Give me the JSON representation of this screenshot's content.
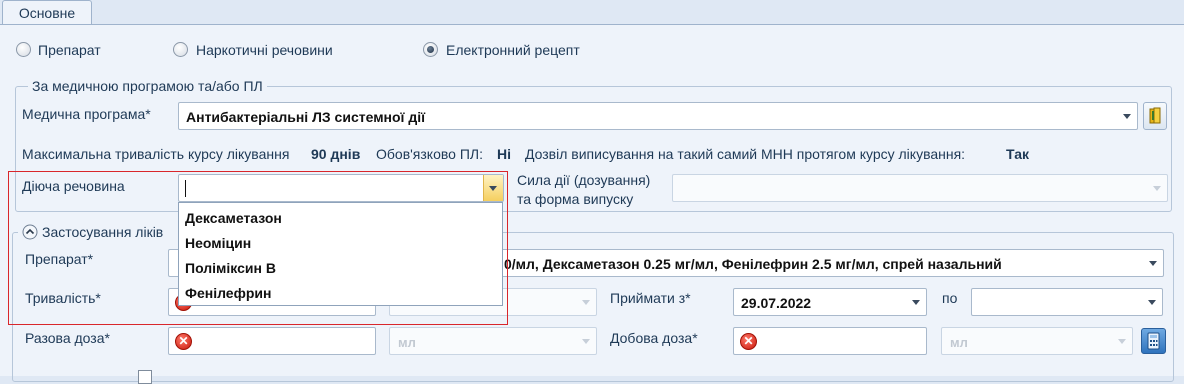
{
  "tab": {
    "label": "Основне"
  },
  "radios": [
    {
      "label": "Препарат",
      "checked": false
    },
    {
      "label": "Наркотичні речовини",
      "checked": false
    },
    {
      "label": "Електронний рецепт",
      "checked": true
    }
  ],
  "group": {
    "legend": "За медичною програмою та/або ПЛ",
    "program_label": "Медична програма*",
    "program_value": "Антибактеріальні ЛЗ системної дії",
    "max_duration_label": "Максимальна тривалість курсу лікування",
    "max_duration_value": "90 днів",
    "required_pl_label": "Обов'язково ПЛ:",
    "required_pl_value": "Ні",
    "allow_label": "Дозвіл виписування на такий самий МНН протягом курсу лікування:",
    "allow_value": "Так",
    "substance_label": "Діюча речовина",
    "substance_value": "",
    "strength_label_line1": "Сила дії (дозування)",
    "strength_label_line2": "та форма випуску"
  },
  "application": {
    "legend": "Застосування ліків",
    "drug_label": "Препарат*",
    "drug_value_visible": "0/мл, Дексаметазон 0.25 мг/мл, Фенілефрин 2.5 мг/мл, спрей назальний",
    "duration_label": "Тривалість*",
    "take_from_label": "Приймати з*",
    "take_from_value": "29.07.2022",
    "to_label": "по",
    "single_dose_label": "Разова доза*",
    "unit_placeholder": "мл",
    "daily_dose_label": "Добова доза*"
  },
  "dropdown_items": [
    "Дексаметазон",
    "Неоміцин",
    "Поліміксин В",
    "Фенілефрин"
  ],
  "icons": {
    "error": "x-circle-icon",
    "book": "book-icon",
    "calculator": "calculator-icon",
    "collapse": "chevron-up-circle-icon"
  },
  "colors": {
    "highlight_border": "#d9262b",
    "error": "#c8160a"
  }
}
